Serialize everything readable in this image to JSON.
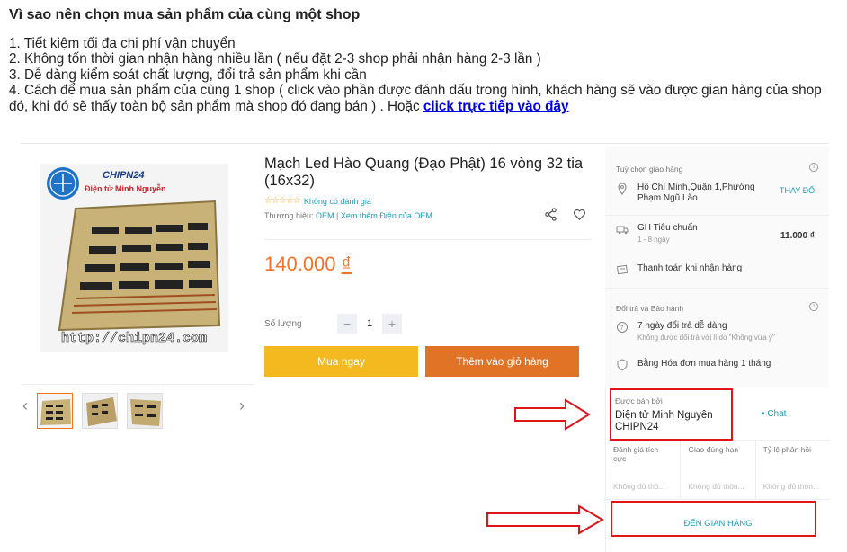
{
  "intro": {
    "title": "Vì sao nên chọn mua sản phẩm của cùng một shop",
    "items": [
      "1. Tiết kiệm tối đa chi phí vận chuyển",
      "2. Không tốn thời gian nhận hàng nhiều lần ( nếu đặt 2-3 shop phải nhận hàng 2-3 lần )",
      "3. Dễ dàng kiểm soát chất lượng, đổi trả sản phẩm khi cần",
      "4. Cách để mua sản phẩm của cùng 1 shop ( click vào phần được đánh dấu trong hình, khách hàng sẽ vào được gian hàng của shop đó, khi đó sẽ thấy toàn bộ sản phẩm mà shop đó đang bán ) . Hoặc"
    ],
    "link_label": "click trực tiếp vào đây"
  },
  "product": {
    "image_brand": "CHIPN24",
    "image_subtitle": "Điện tử Minh Nguyễn",
    "image_url_text": "http://chipn24.com",
    "title": "Mạch Led Hào Quang (Đạo Phật) 16 vòng 32 tia (16x32)",
    "rating_text": "Không có đánh giá",
    "brand_label": "Thương hiệu:",
    "brand_value": "OEM",
    "brand_more": "Xem thêm Điện của OEM",
    "price": "140.000",
    "currency": "₫",
    "qty_label": "Số lượng",
    "qty_value": "1",
    "buy_now": "Mua ngay",
    "add_to_cart": "Thêm vào giỏ hàng"
  },
  "delivery": {
    "section_label": "Tuỳ chọn giao hàng",
    "address": "Hồ Chí Minh,Quận 1,Phường Phạm Ngũ Lão",
    "change": "THAY ĐỔI",
    "method": "GH Tiêu chuẩn",
    "method_time": "1 - 8 ngày",
    "method_price": "11.000 ₫",
    "cod": "Thanh toán khi nhận hàng"
  },
  "warranty": {
    "section_label": "Đổi trả và Bảo hành",
    "returns": "7 ngày đổi trả dễ dàng",
    "returns_sub": "Không được đổi trả với lí do \"Không vừa ý\"",
    "invoice": "Bằng Hóa đơn mua hàng 1 tháng"
  },
  "seller": {
    "label": "Được bán bởi",
    "name": "Điện tử Minh Nguyên CHIPN24",
    "chat": "Chat",
    "metrics": [
      {
        "label": "Đánh giá tích cực",
        "value": "Không đủ thô..."
      },
      {
        "label": "Giao đúng hạn",
        "value": "Không đủ thôn..."
      },
      {
        "label": "Tỷ lệ phản hồi",
        "value": "Không đủ thôn..."
      }
    ],
    "store_link": "ĐẾN GIAN HÀNG"
  },
  "colors": {
    "price": "#f57224",
    "buy": "#f4b91e",
    "cart": "#e07325",
    "link": "#1a9cb7",
    "highlight": "#e0151a"
  }
}
